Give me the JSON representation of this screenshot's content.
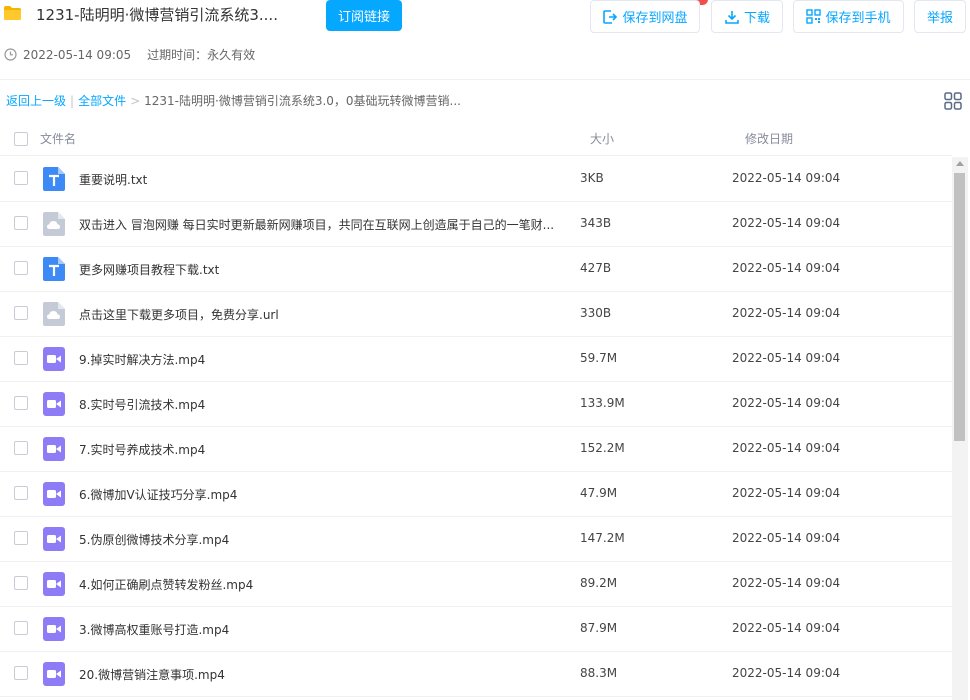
{
  "header": {
    "title": "1231-陆明明·微博营销引流系统3....",
    "subscribe_label": "订阅链接",
    "save_pan_label": "保存到网盘",
    "download_label": "下载",
    "save_phone_label": "保存到手机",
    "report_label": "举报",
    "created_time": "2022-05-14 09:05",
    "expire_label": "过期时间：永久有效"
  },
  "breadcrumb": {
    "back_label": "返回上一级",
    "separator": "|",
    "all_files_label": "全部文件",
    "arrow": ">",
    "current": "1231-陆明明·微博营销引流系统3.0，0基础玩转微博营销..."
  },
  "table": {
    "columns": {
      "name": "文件名",
      "size": "大小",
      "date": "修改日期"
    },
    "rows": [
      {
        "icon": "txt-file-icon",
        "name": "重要说明.txt",
        "size": "3KB",
        "date": "2022-05-14 09:04"
      },
      {
        "icon": "cloud-file-icon",
        "name": "双击进入 冒泡网赚 每日实时更新最新网赚项目，共同在互联网上创造属于自己的一笔财...",
        "size": "343B",
        "date": "2022-05-14 09:04"
      },
      {
        "icon": "txt-file-icon",
        "name": "更多网赚项目教程下载.txt",
        "size": "427B",
        "date": "2022-05-14 09:04"
      },
      {
        "icon": "cloud-file-icon",
        "name": "点击这里下载更多项目，免费分享.url",
        "size": "330B",
        "date": "2022-05-14 09:04"
      },
      {
        "icon": "video-file-icon",
        "name": "9.掉实时解决方法.mp4",
        "size": "59.7M",
        "date": "2022-05-14 09:04"
      },
      {
        "icon": "video-file-icon",
        "name": "8.实时号引流技术.mp4",
        "size": "133.9M",
        "date": "2022-05-14 09:04"
      },
      {
        "icon": "video-file-icon",
        "name": "7.实时号养成技术.mp4",
        "size": "152.2M",
        "date": "2022-05-14 09:04"
      },
      {
        "icon": "video-file-icon",
        "name": "6.微博加V认证技巧分享.mp4",
        "size": "47.9M",
        "date": "2022-05-14 09:04"
      },
      {
        "icon": "video-file-icon",
        "name": "5.伪原创微博技术分享.mp4",
        "size": "147.2M",
        "date": "2022-05-14 09:04"
      },
      {
        "icon": "video-file-icon",
        "name": "4.如何正确刷点赞转发粉丝.mp4",
        "size": "89.2M",
        "date": "2022-05-14 09:04"
      },
      {
        "icon": "video-file-icon",
        "name": "3.微博高权重账号打造.mp4",
        "size": "87.9M",
        "date": "2022-05-14 09:04"
      },
      {
        "icon": "video-file-icon",
        "name": "20.微博营销注意事项.mp4",
        "size": "88.3M",
        "date": "2022-05-14 09:04"
      }
    ]
  },
  "colors": {
    "accent": "#06a7ff",
    "txt_icon": "#3d8af7",
    "cloud_icon": "#c4cbd6",
    "video_icon": "#8d7cf5",
    "folder_icon": "#f5b400"
  }
}
